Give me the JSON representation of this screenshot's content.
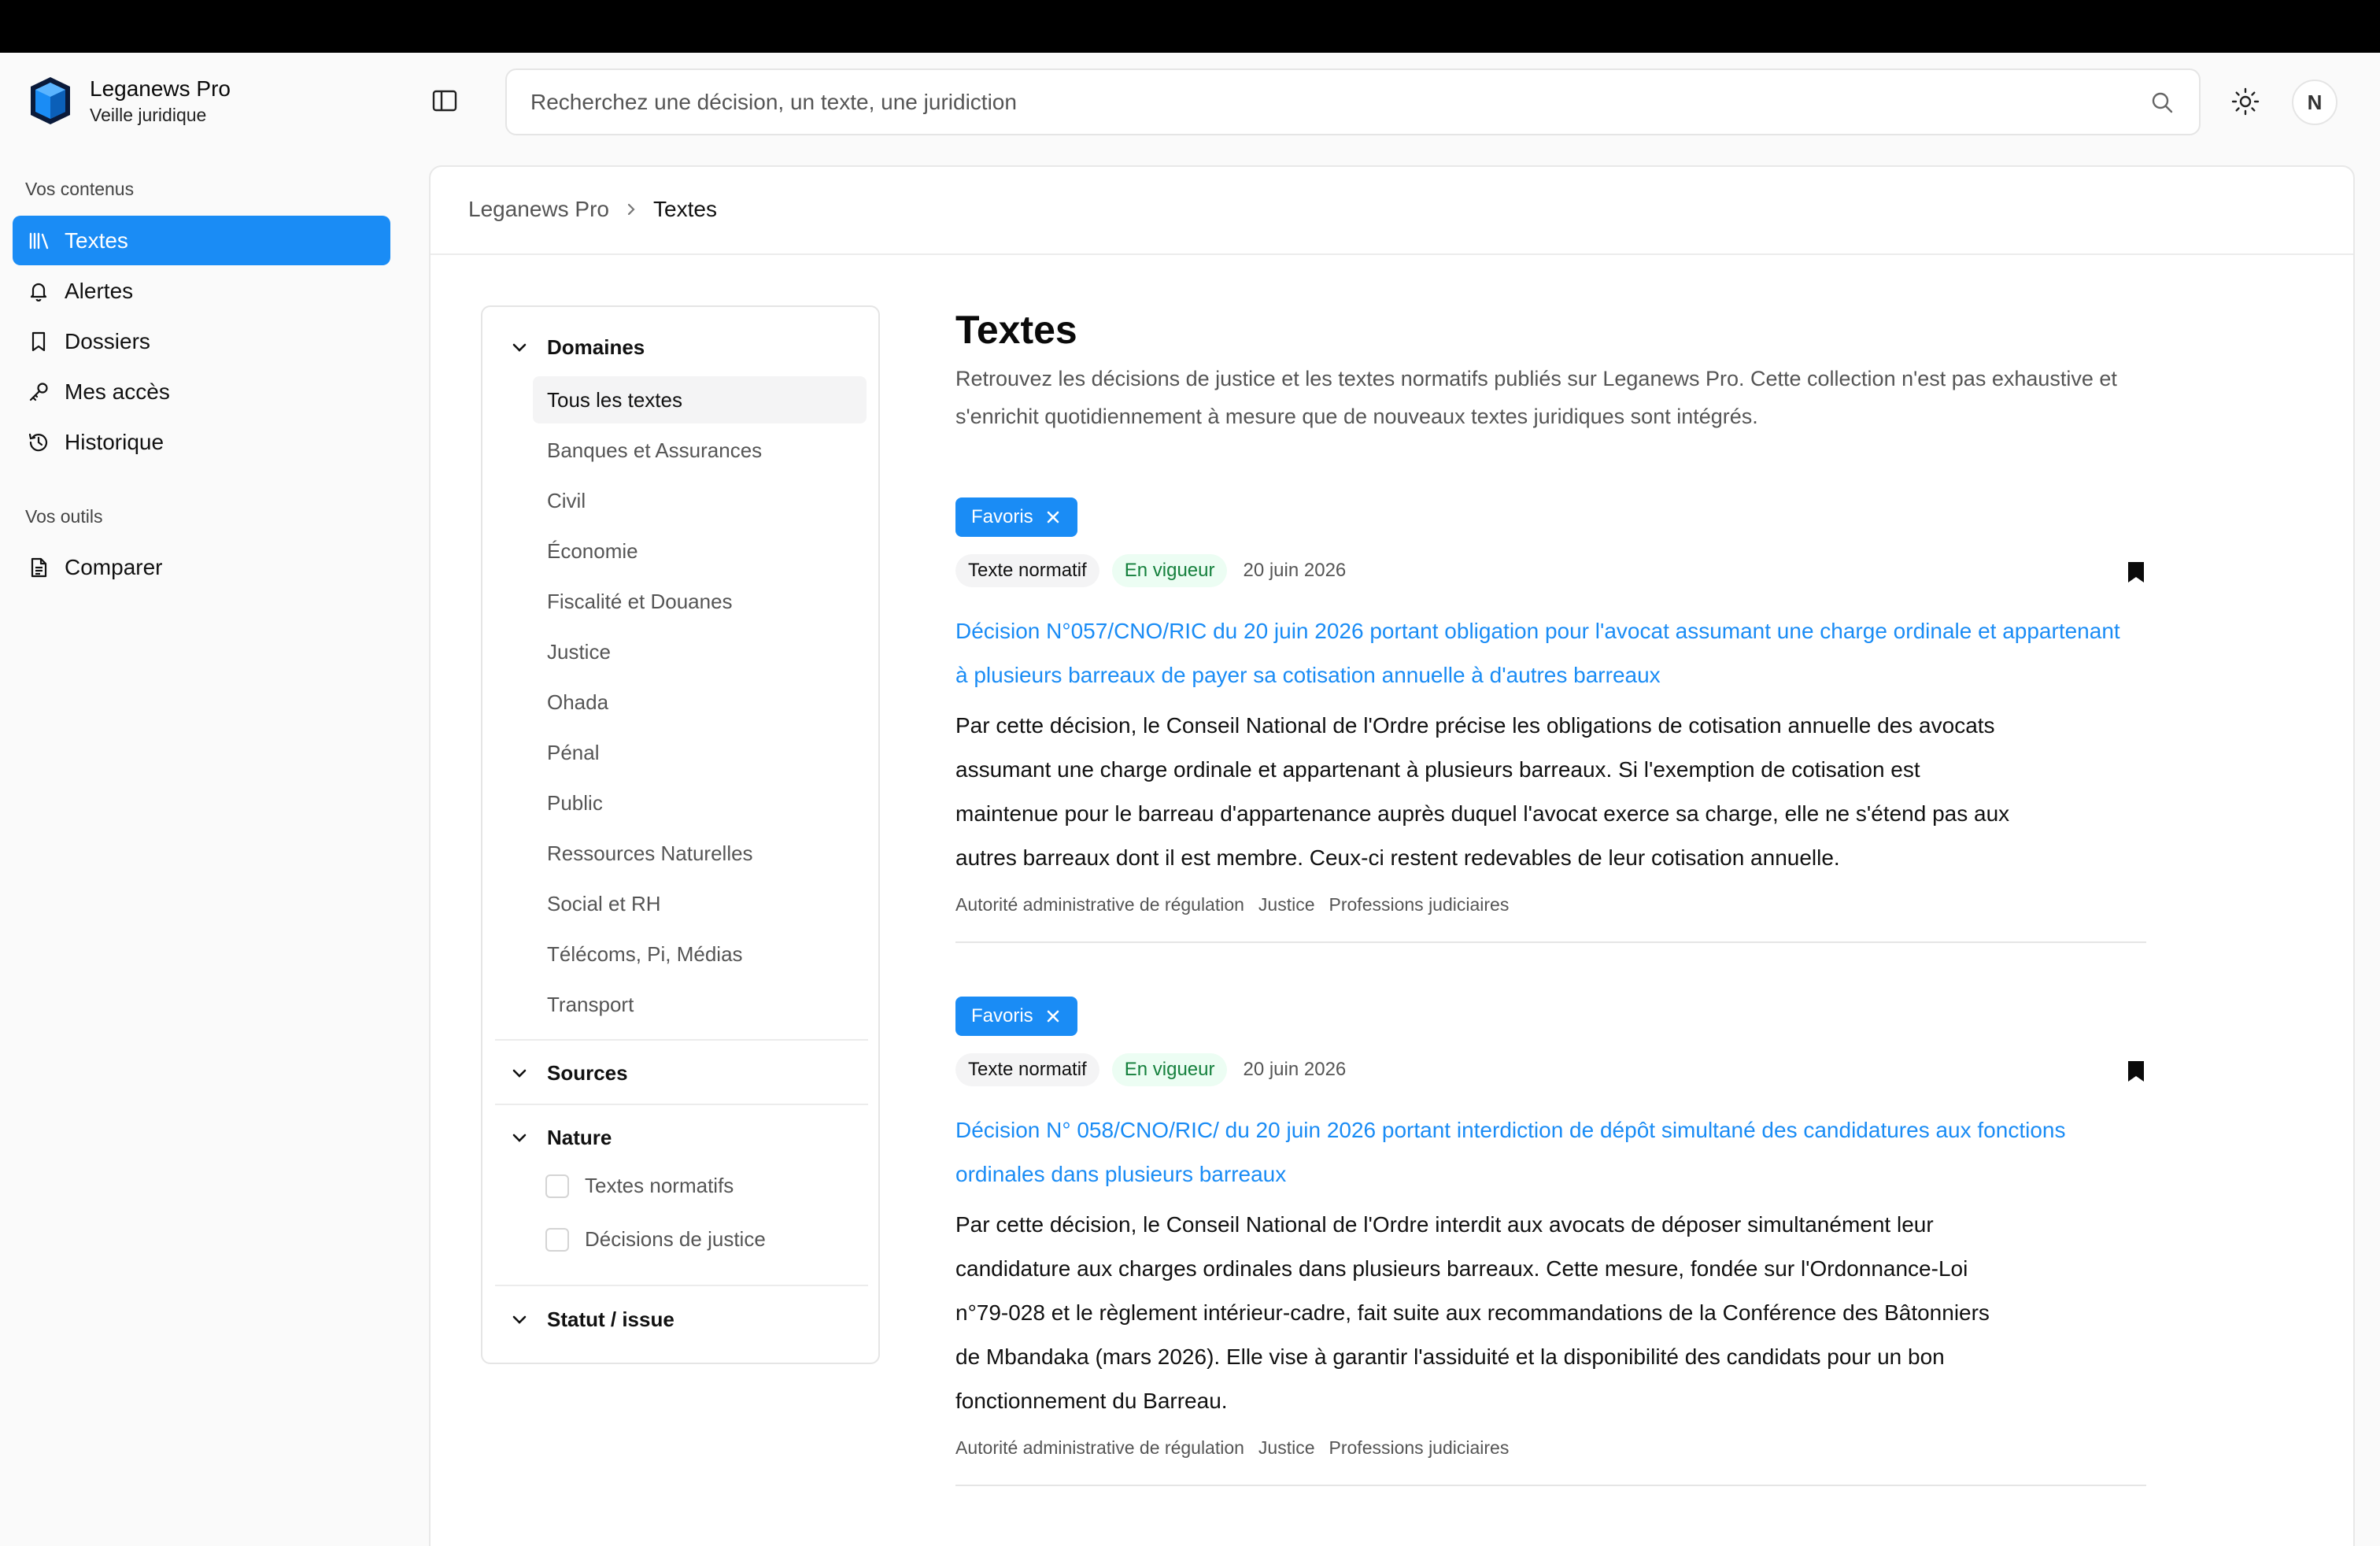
{
  "app": {
    "name": "Leganews Pro",
    "tagline": "Veille juridique"
  },
  "sidebar": {
    "section_contents": "Vos contenus",
    "items": [
      {
        "label": "Textes",
        "icon": "library-icon",
        "active": true
      },
      {
        "label": "Alertes",
        "icon": "bell-icon"
      },
      {
        "label": "Dossiers",
        "icon": "bookmark-icon"
      },
      {
        "label": "Mes accès",
        "icon": "key-icon"
      },
      {
        "label": "Historique",
        "icon": "history-icon"
      }
    ],
    "section_tools": "Vos outils",
    "tools": [
      {
        "label": "Comparer",
        "icon": "document-icon"
      }
    ]
  },
  "header": {
    "search_placeholder": "Recherchez une décision, un texte, une juridiction",
    "avatar_initial": "N"
  },
  "breadcrumb": {
    "root": "Leganews Pro",
    "current": "Textes"
  },
  "filters": {
    "domains_label": "Domaines",
    "domains": [
      "Tous les textes",
      "Banques et Assurances",
      "Civil",
      "Économie",
      "Fiscalité et Douanes",
      "Justice",
      "Ohada",
      "Pénal",
      "Public",
      "Ressources Naturelles",
      "Social et RH",
      "Télécoms, Pi, Médias",
      "Transport"
    ],
    "selected_domain": "Tous les textes",
    "sources_label": "Sources",
    "nature_label": "Nature",
    "nature_options": [
      "Textes normatifs",
      "Décisions de justice"
    ],
    "status_label": "Statut / issue"
  },
  "page": {
    "title": "Textes",
    "description": "Retrouvez les décisions de justice et les textes normatifs publiés sur Leganews Pro. Cette collection n'est pas exhaustive et s'enrichit quotidiennement à mesure que de nouveaux textes juridiques sont intégrés."
  },
  "results": [
    {
      "chip": "Favoris",
      "type": "Texte normatif",
      "status": "En vigueur",
      "date": "20 juin 2026",
      "title": "Décision N°057/CNO/RIC du 20 juin 2026 portant obligation pour l'avocat assumant une charge ordinale et appartenant à plusieurs barreaux de payer sa cotisation annuelle à d'autres barreaux",
      "summary": "Par cette décision, le Conseil National de l'Ordre précise les obligations de cotisation annuelle des avocats assumant une charge ordinale et appartenant à plusieurs barreaux. Si l'exemption de cotisation est maintenue pour le barreau d'appartenance auprès duquel l'avocat exerce sa charge, elle ne s'étend pas aux autres barreaux dont il est membre. Ceux-ci restent redevables de leur cotisation annuelle.",
      "tags": [
        "Autorité administrative de régulation",
        "Justice",
        "Professions judiciaires"
      ]
    },
    {
      "chip": "Favoris",
      "type": "Texte normatif",
      "status": "En vigueur",
      "date": "20 juin 2026",
      "title": "Décision N° 058/CNO/RIC/ du 20 juin 2026 portant interdiction de dépôt simultané des candidatures aux fonctions ordinales dans plusieurs barreaux",
      "summary": "Par cette décision, le Conseil National de l'Ordre interdit aux avocats de déposer simultanément leur candidature aux charges ordinales dans plusieurs barreaux. Cette mesure, fondée sur l'Ordonnance-Loi n°79-028 et le règlement intérieur-cadre, fait suite aux recommandations de la Conférence des Bâtonniers de Mbandaka (mars 2026). Elle vise à garantir l'assiduité et la disponibilité des candidats pour un bon fonctionnement du Barreau.",
      "tags": [
        "Autorité administrative de régulation",
        "Justice",
        "Professions judiciaires"
      ]
    }
  ],
  "colors": {
    "accent": "#1a8cf5",
    "status_green": "#15803d"
  }
}
